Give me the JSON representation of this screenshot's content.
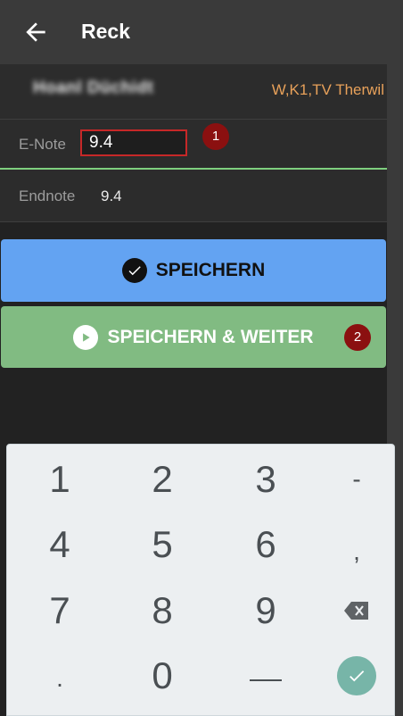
{
  "header": {
    "title": "Reck",
    "back_icon": "arrow-left-icon"
  },
  "athlete": {
    "name": "Hoanl Düchidt",
    "club": "W,K1,TV Therwil"
  },
  "enote": {
    "label": "E-Note",
    "value": "9.4"
  },
  "endnote": {
    "label": "Endnote",
    "value": "9.4"
  },
  "buttons": {
    "save": {
      "label": "SPEICHERN",
      "icon": "check-circle-icon"
    },
    "save_next": {
      "label": "SPEICHERN & WEITER",
      "icon": "play-circle-icon"
    }
  },
  "markers": [
    "1",
    "2"
  ],
  "keypad": {
    "keys": [
      "1",
      "2",
      "3",
      "-",
      "4",
      "5",
      "6",
      ",",
      "7",
      "8",
      "9",
      "backspace",
      ".",
      " 0",
      "_",
      "done"
    ],
    "digits": {
      "k1": "1",
      "k2": "2",
      "k3": "3",
      "k4": "4",
      "k5": "5",
      "k6": "6",
      "k7": "7",
      "k8": "8",
      "k9": "9",
      "k0": "0",
      "minus": "-",
      "comma": ",",
      "dot": ".",
      "space": "⎵"
    }
  },
  "colors": {
    "accent_blue": "#63a3f2",
    "accent_green": "#81bb82",
    "club_orange": "#e8a15a",
    "marker_red": "#8b1010"
  }
}
